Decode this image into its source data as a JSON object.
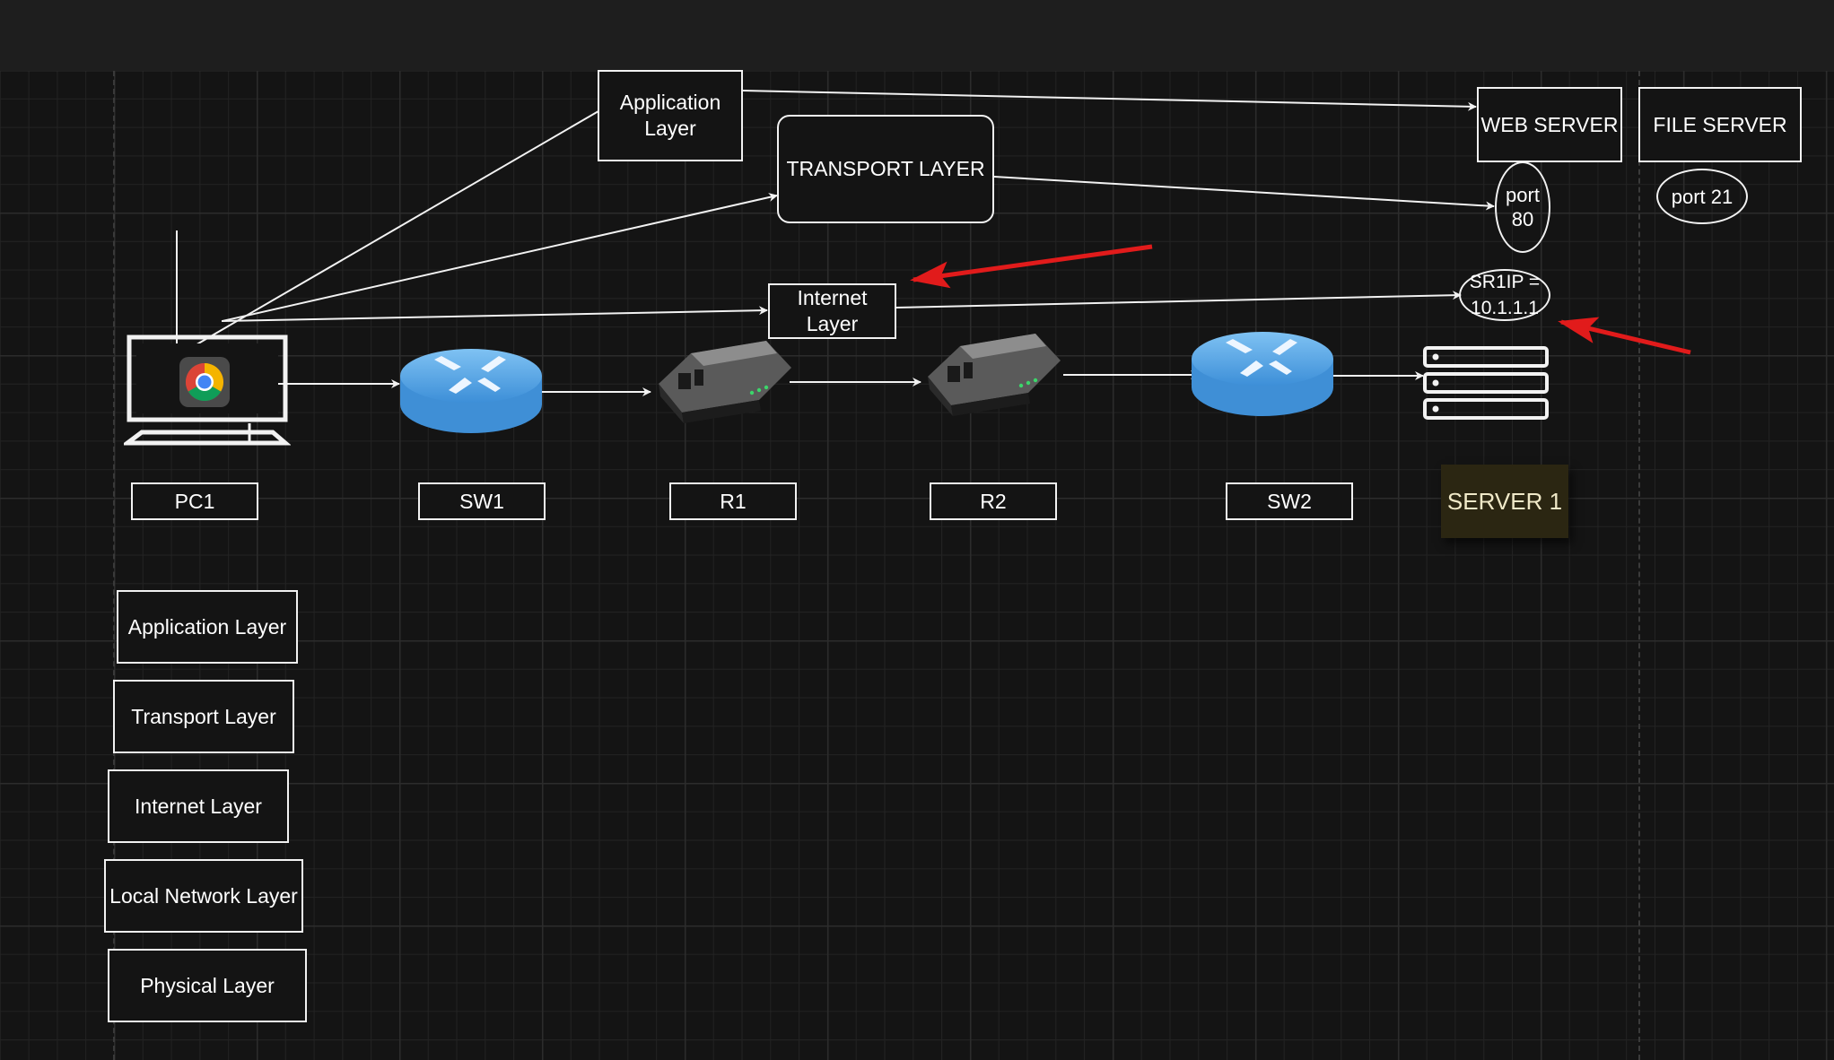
{
  "colors": {
    "background": "#141414",
    "grid": "#2c2c2c",
    "stroke": "#f2f2f2",
    "annotation_arrow": "#e11b1b",
    "router": "#5aa9e6",
    "server_label_bg": "#2b2612"
  },
  "devices": [
    {
      "id": "pc1",
      "label": "PC1",
      "icon": "computer-with-chrome-icon"
    },
    {
      "id": "sw1",
      "label": "SW1",
      "icon": "router-icon"
    },
    {
      "id": "r1",
      "label": "R1",
      "icon": "modem-icon"
    },
    {
      "id": "r2",
      "label": "R2",
      "icon": "modem-icon"
    },
    {
      "id": "sw2",
      "label": "SW2",
      "icon": "router-icon"
    },
    {
      "id": "server1",
      "label": "SERVER 1",
      "icon": "server-rack-icon"
    }
  ],
  "top_layers": {
    "application": "Application Layer",
    "transport": "TRANSPORT LAYER",
    "internet": "Internet Layer"
  },
  "servers": {
    "web_server": "WEB SERVER",
    "file_server": "FILE SERVER",
    "port_80": "port 80",
    "port_21": "port 21",
    "sr1ip": "SR1IP = 10.1.1.1"
  },
  "layer_stack": [
    "Application Layer",
    "Transport Layer",
    "Internet Layer",
    "Local Network Layer",
    "Physical Layer"
  ]
}
